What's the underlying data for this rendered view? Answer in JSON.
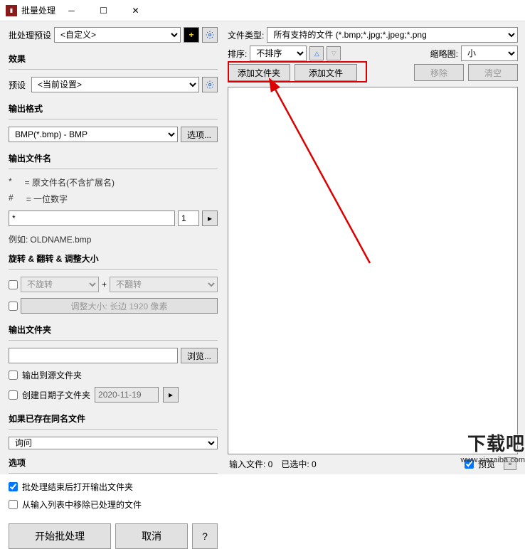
{
  "window": {
    "title": "批量处理"
  },
  "left": {
    "preset_label": "批处理预设",
    "preset_value": "<自定义>",
    "effects_title": "效果",
    "effects_preset_label": "预设",
    "effects_preset_value": "<当前设置>",
    "format_title": "输出格式",
    "format_value": "BMP(*.bmp) - BMP",
    "options_btn": "选项...",
    "filename_title": "输出文件名",
    "filename_hint1_sym": "*",
    "filename_hint1_txt": "= 原文件名(不含扩展名)",
    "filename_hint2_sym": "#",
    "filename_hint2_txt": "= 一位数字",
    "filename_value": "*",
    "filename_num": "1",
    "filename_example_label": "例如:",
    "filename_example_value": "OLDNAME.bmp",
    "transform_title": "旋转 & 翻转 & 调整大小",
    "rotate_value": "不旋转",
    "flip_value": "不翻转",
    "resize_text": "调整大小: 长边 1920 像素",
    "folder_title": "输出文件夹",
    "browse_btn": "浏览...",
    "cb_output_source": "输出到源文件夹",
    "cb_date_folder": "创建日期子文件夹",
    "date_value": "2020-11-19",
    "exists_title": "如果已存在同名文件",
    "exists_value": "询问",
    "opts_title": "选项",
    "cb_open_after": "批处理结束后打开输出文件夹",
    "cb_remove_processed": "从输入列表中移除已处理的文件",
    "start_btn": "开始批处理",
    "cancel_btn": "取消",
    "help_btn": "?"
  },
  "right": {
    "filetype_label": "文件类型:",
    "filetype_value": "所有支持的文件 (*.bmp;*.jpg;*.jpeg;*.png",
    "sort_label": "排序:",
    "sort_value": "不排序",
    "thumb_label": "缩略图:",
    "thumb_value": "小",
    "add_folder_btn": "添加文件夹",
    "add_file_btn": "添加文件",
    "remove_btn": "移除",
    "clear_btn": "清空",
    "status_files": "输入文件: 0",
    "status_selected": "已选中: 0",
    "preview_cb": "预览"
  },
  "watermark": {
    "cn": "下载吧",
    "url": "www.xiazaiba.com"
  }
}
